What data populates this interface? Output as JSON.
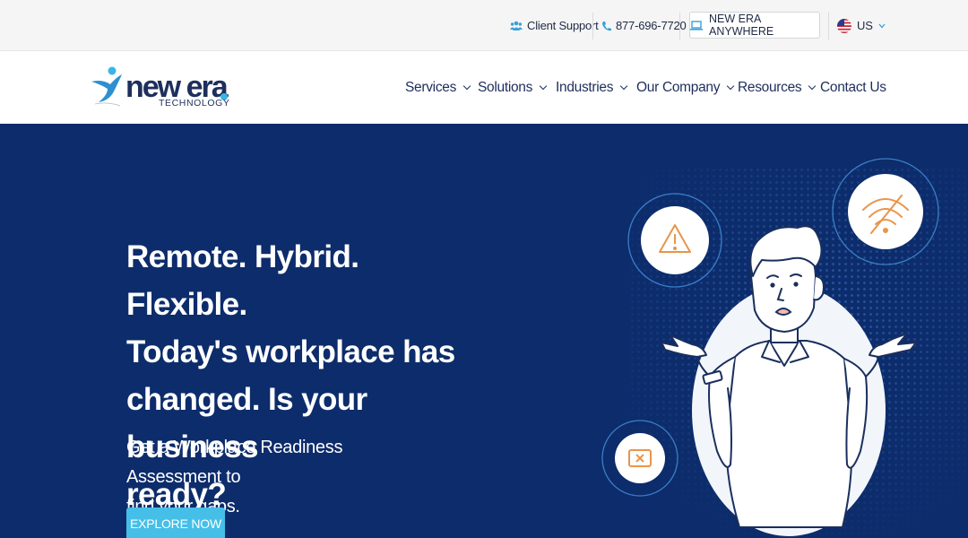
{
  "topbar": {
    "client_support": "Client Support",
    "phone": "877-696-7720",
    "anywhere": "NEW ERA ANYWHERE",
    "region": "US"
  },
  "logo": {
    "name": "new era",
    "subtitle": "TECHNOLOGY"
  },
  "nav": {
    "items": [
      {
        "label": "Services",
        "has_dropdown": true
      },
      {
        "label": "Solutions",
        "has_dropdown": true
      },
      {
        "label": "Industries",
        "has_dropdown": true
      },
      {
        "label": "Our Company",
        "has_dropdown": true
      },
      {
        "label": "Resources",
        "has_dropdown": true
      },
      {
        "label": "Contact Us",
        "has_dropdown": false
      }
    ]
  },
  "hero": {
    "headline_lines": [
      "Remote. Hybrid. Flexible.",
      "Today's workplace has",
      "changed. Is your business",
      "ready?"
    ],
    "subline_lines": [
      "Get a Workplace Readiness Assessment to",
      "find your gaps."
    ],
    "cta": "EXPLORE NOW"
  },
  "colors": {
    "hero_bg": "#0d2c6b",
    "accent": "#45bfe8",
    "brand_text": "#1e2f5c",
    "icon_orange": "#e8954a"
  },
  "icons": [
    "people-icon",
    "phone-icon",
    "laptop-icon",
    "us-flag-icon",
    "warning-icon",
    "no-wifi-icon",
    "error-x-icon"
  ]
}
